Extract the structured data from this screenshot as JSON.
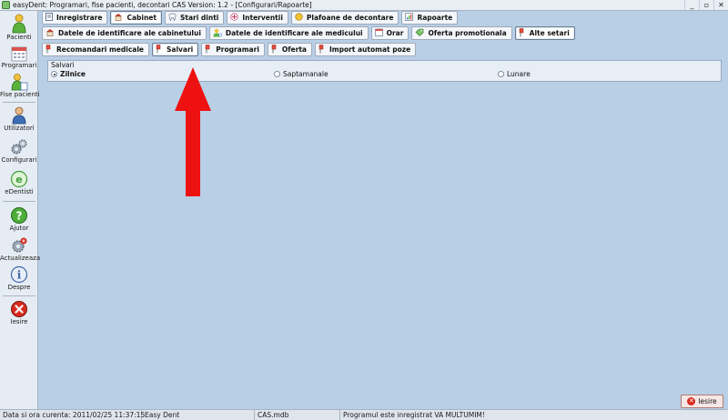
{
  "window": {
    "title": "easyDent: Programari,  fise pacienti, decontari CAS   Version: 1.2 - [Configurari/Rapoarte]",
    "minimize": "_",
    "restore": "▫",
    "close": "✕"
  },
  "sidebar": {
    "items": [
      {
        "label": "Pacienti",
        "icon": "patients-icon"
      },
      {
        "label": "Programari",
        "icon": "calendar-icon"
      },
      {
        "label": "Fise pacienti",
        "icon": "patient-files-icon"
      },
      {
        "label": "Utilizatori",
        "icon": "users-icon"
      },
      {
        "label": "Configurari",
        "icon": "gears-icon"
      },
      {
        "label": "eDentisti",
        "icon": "edentisti-icon"
      },
      {
        "label": "Ajutor",
        "icon": "help-icon"
      },
      {
        "label": "Actualizeaza",
        "icon": "update-icon"
      },
      {
        "label": "Despre",
        "icon": "info-icon"
      },
      {
        "label": "Iesire",
        "icon": "exit-icon"
      }
    ]
  },
  "tabs_row1": [
    {
      "label": "Inregistrare",
      "icon": "document-icon",
      "active": false
    },
    {
      "label": "Cabinet",
      "icon": "cabinet-icon",
      "active": true
    },
    {
      "label": "Stari dinti",
      "icon": "tooth-icon",
      "active": false
    },
    {
      "label": "Interventii",
      "icon": "intervention-icon",
      "active": false
    },
    {
      "label": "Plafoane de decontare",
      "icon": "coins-icon",
      "active": false
    },
    {
      "label": "Rapoarte",
      "icon": "report-icon",
      "active": false
    }
  ],
  "tabs_row2": [
    {
      "label": "Datele de identificare ale cabinetului",
      "icon": "cabinet-id-icon",
      "active": false
    },
    {
      "label": "Datele de identificare ale medicului",
      "icon": "doctor-id-icon",
      "active": false
    },
    {
      "label": "Orar",
      "icon": "schedule-icon",
      "active": false
    },
    {
      "label": "Oferta promotionala",
      "icon": "promo-icon",
      "active": false
    },
    {
      "label": "Alte setari",
      "icon": "settings-pin-icon",
      "active": true
    }
  ],
  "tabs_row3": [
    {
      "label": "Recomandari medicale",
      "icon": "pin-icon",
      "active": false
    },
    {
      "label": "Salvari",
      "icon": "pin-icon",
      "active": true
    },
    {
      "label": "Programari",
      "icon": "pin-icon",
      "active": false
    },
    {
      "label": "Oferta",
      "icon": "pin-icon",
      "active": false
    },
    {
      "label": "Import automat poze",
      "icon": "pin-icon",
      "active": false
    }
  ],
  "backup": {
    "legend": "Salvari",
    "options": [
      {
        "label": "Zilnice",
        "selected": true
      },
      {
        "label": "Saptamanale",
        "selected": false
      },
      {
        "label": "Lunare",
        "selected": false
      }
    ]
  },
  "exit_button": {
    "label": "Iesire"
  },
  "status": {
    "datetime": "Data si ora curenta: 2011/02/25 11:37:15",
    "app": "Easy Dent",
    "db": "CAS.mdb",
    "registration": "Programul este inregistrat VA MULTUMIM!"
  },
  "colors": {
    "background": "#b9cfe6",
    "arrow": "#ee1111"
  }
}
